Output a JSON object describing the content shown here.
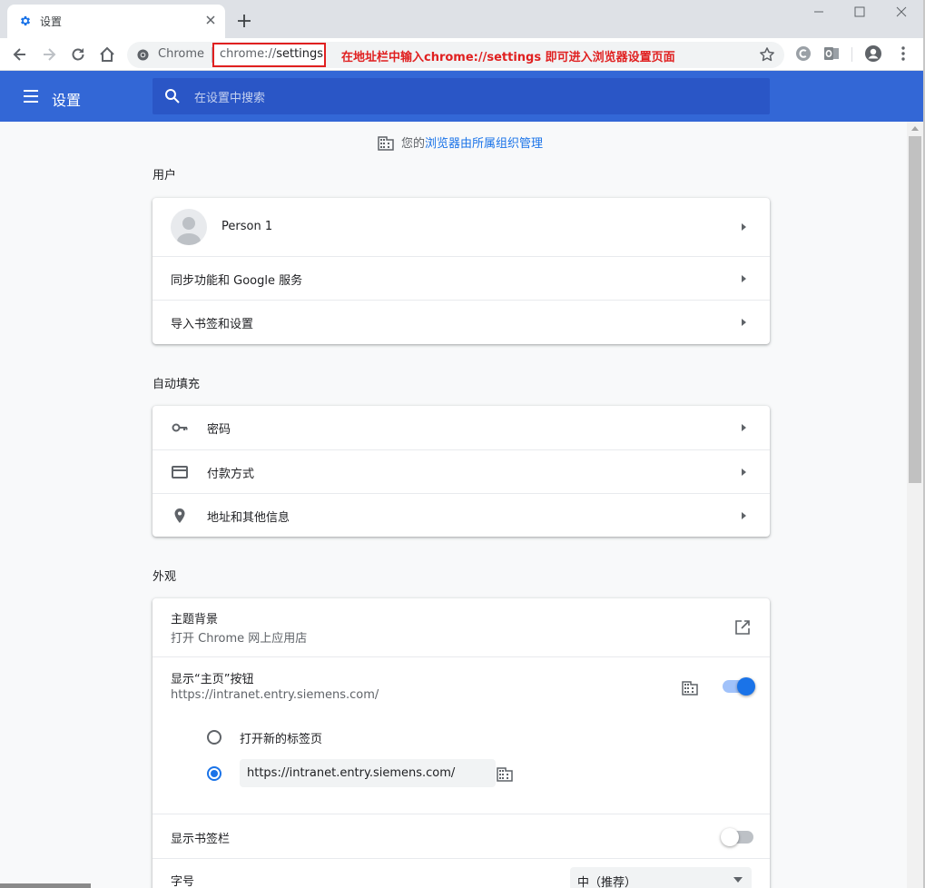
{
  "window": {
    "tab_title": "设置",
    "toolbar_chip": "Chrome",
    "url_scheme": "chrome://",
    "url_path": "settings",
    "annotation": "在地址栏中输入chrome://settings 即可进入浏览器设置页面"
  },
  "header": {
    "title": "设置",
    "search_placeholder": "在设置中搜索"
  },
  "managed_notice": {
    "prefix": "您的",
    "link": "浏览器由所属组织管理"
  },
  "sections": {
    "people": {
      "title": "用户",
      "person": "Person 1",
      "sync": "同步功能和 Google 服务",
      "import": "导入书签和设置"
    },
    "autofill": {
      "title": "自动填充",
      "passwords": "密码",
      "payments": "付款方式",
      "addresses": "地址和其他信息"
    },
    "appearance": {
      "title": "外观",
      "theme_label": "主题背景",
      "theme_sub": "打开 Chrome 网上应用店",
      "home_label": "显示“主页”按钮",
      "home_sub": "https://intranet.entry.siemens.com/",
      "home_toggle_on": true,
      "radio_newtab": "打开新的标签页",
      "radio_url_value": "https://intranet.entry.siemens.com/",
      "bookmarks_label": "显示书签栏",
      "bookmarks_toggle_on": false,
      "font_size_label": "字号",
      "font_size_value": "中（推荐）"
    }
  },
  "colors": {
    "accent": "#3367d6",
    "link": "#1a73e8",
    "annotation": "#e02020"
  }
}
